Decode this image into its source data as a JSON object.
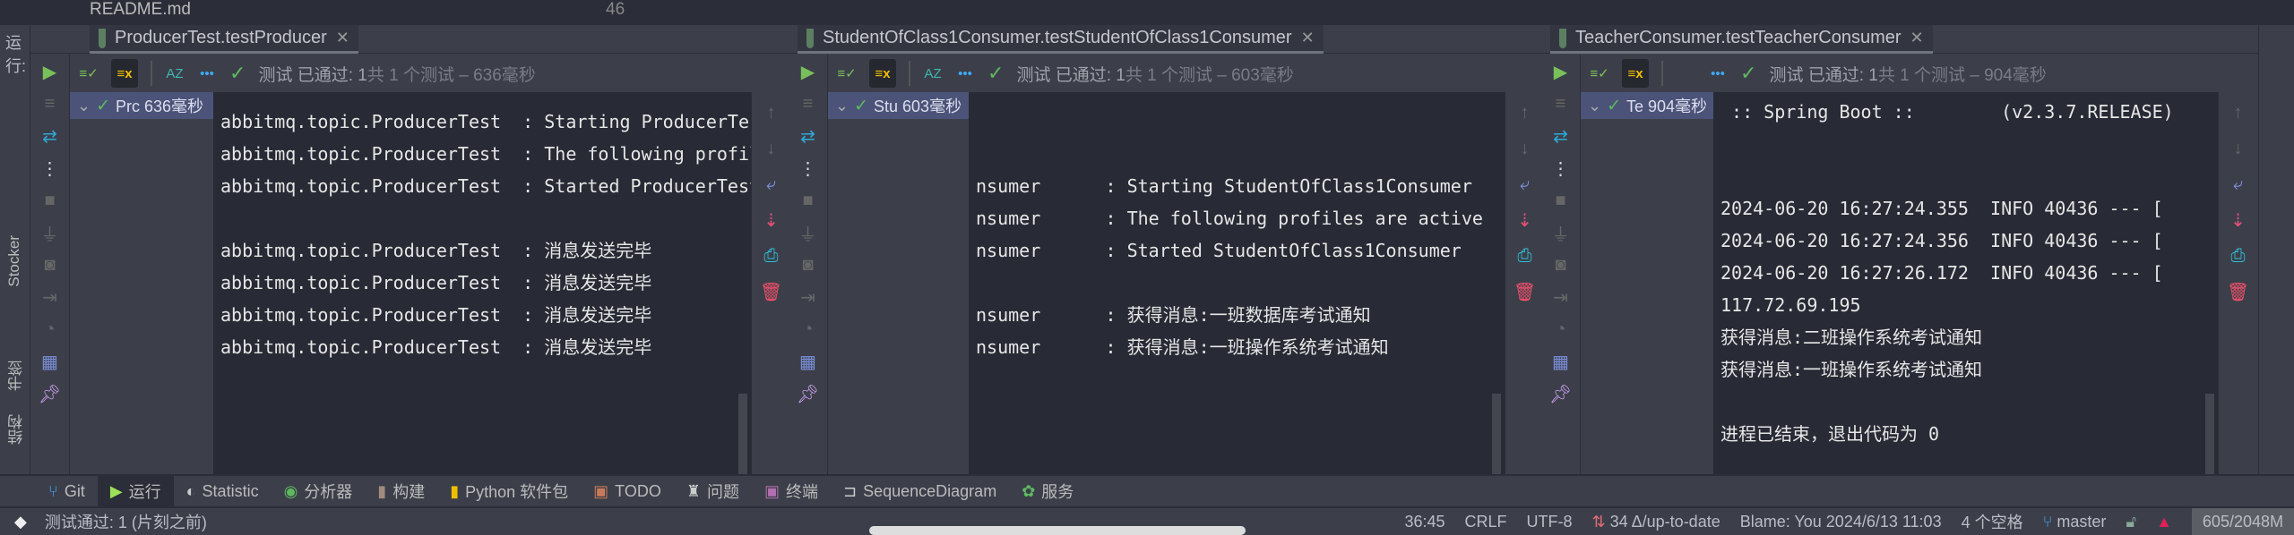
{
  "top": {
    "file": "README.md",
    "line_number": "46"
  },
  "run_label": "运行:",
  "left_strip": [
    "Stocker",
    "书签",
    "结构"
  ],
  "panels": [
    {
      "tab": "ProducerTest.testProducer",
      "status_prefix": "测试 已通过: 1",
      "status_suffix": "共 1 个测试 – 636毫秒",
      "tree_node": "Prc 636毫秒",
      "lines": [
        "abbitmq.topic.ProducerTest  : Starting ProducerTest",
        "abbitmq.topic.ProducerTest  : The following profiles",
        "abbitmq.topic.ProducerTest  : Started ProducerTest",
        "",
        "abbitmq.topic.ProducerTest  : 消息发送完毕",
        "abbitmq.topic.ProducerTest  : 消息发送完毕",
        "abbitmq.topic.ProducerTest  : 消息发送完毕",
        "abbitmq.topic.ProducerTest  : 消息发送完毕"
      ]
    },
    {
      "tab": "StudentOfClass1Consumer.testStudentOfClass1Consumer",
      "status_prefix": "测试 已通过: 1",
      "status_suffix": "共 1 个测试 – 603毫秒",
      "tree_node": "Stu 603毫秒",
      "lines": [
        "",
        "",
        "nsumer      : Starting StudentOfClass1Consumer",
        "nsumer      : The following profiles are active",
        "nsumer      : Started StudentOfClass1Consumer",
        "",
        "nsumer      : 获得消息:一班数据库考试通知",
        "nsumer      : 获得消息:一班操作系统考试通知"
      ]
    },
    {
      "tab": "TeacherConsumer.testTeacherConsumer",
      "status_prefix": "测试 已通过: 1",
      "status_suffix": "共 1 个测试 – 904毫秒",
      "tree_node": "Te 904毫秒",
      "lines": [
        " :: Spring Boot ::        (v2.3.7.RELEASE)",
        "",
        "",
        "2024-06-20 16:27:24.355  INFO 40436 --- [",
        "2024-06-20 16:27:24.356  INFO 40436 --- [",
        "2024-06-20 16:27:26.172  INFO 40436 --- [",
        "117.72.69.195",
        "获得消息:二班操作系统考试通知",
        "获得消息:一班操作系统考试通知",
        "",
        "进程已结束，退出代码为 0"
      ]
    }
  ],
  "tool_windows": [
    {
      "label": "Git",
      "icon": "git-icon"
    },
    {
      "label": "运行",
      "icon": "run-icon"
    },
    {
      "label": "Statistic",
      "icon": "statistic-icon"
    },
    {
      "label": "分析器",
      "icon": "profiler-icon"
    },
    {
      "label": "构建",
      "icon": "build-icon"
    },
    {
      "label": "Python 软件包",
      "icon": "python-package-icon"
    },
    {
      "label": "TODO",
      "icon": "todo-icon"
    },
    {
      "label": "问题",
      "icon": "problems-icon"
    },
    {
      "label": "终端",
      "icon": "terminal-icon"
    },
    {
      "label": "SequenceDiagram",
      "icon": "sequence-diagram-icon"
    },
    {
      "label": "服务",
      "icon": "services-icon"
    }
  ],
  "statusbar": {
    "message": "测试通过: 1 (片刻之前)",
    "position": "36:45",
    "line_sep": "CRLF",
    "encoding": "UTF-8",
    "vcs": "34 Δ/up-to-date",
    "blame": "Blame: You 2024/6/13 11:03",
    "indent": "4 个空格",
    "branch": "master",
    "memory": "605/2048M"
  }
}
